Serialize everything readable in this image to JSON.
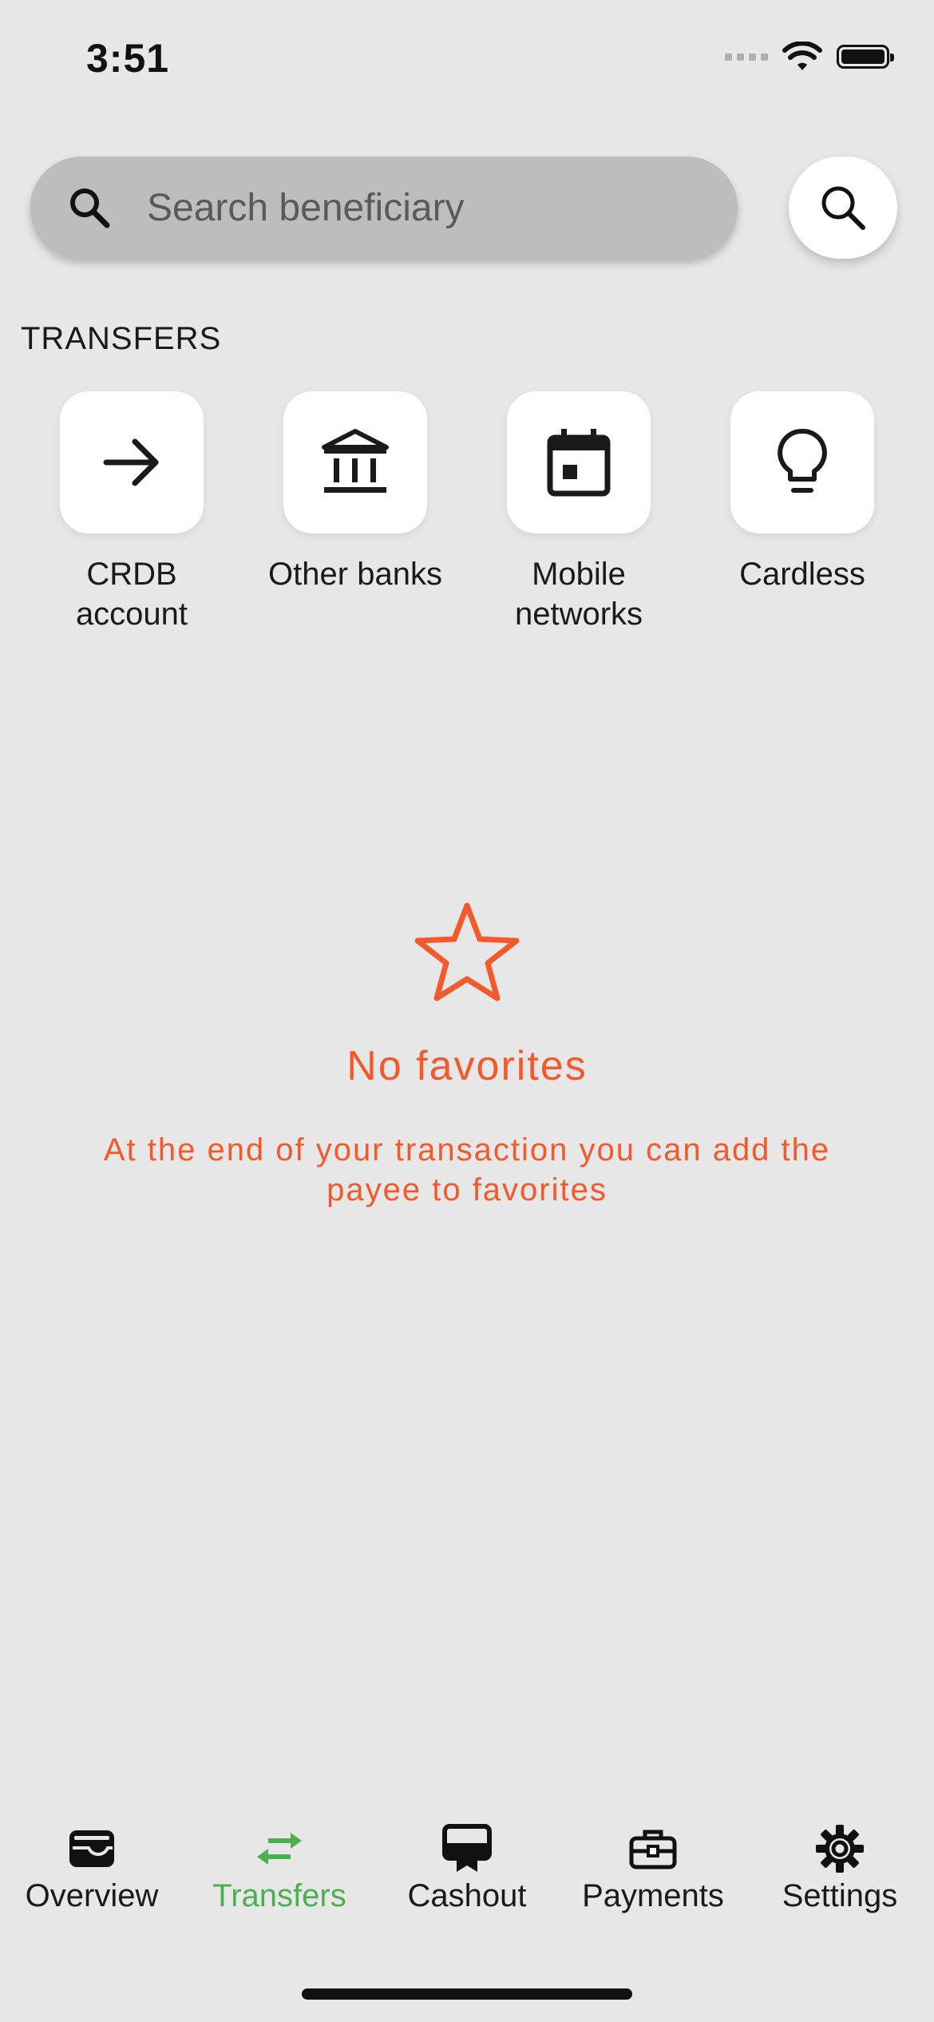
{
  "status_bar": {
    "time": "3:51"
  },
  "search": {
    "placeholder": "Search beneficiary"
  },
  "section": {
    "title": "TRANSFERS"
  },
  "tiles": [
    {
      "label": "CRDB\naccount",
      "icon": "arrow-right-icon"
    },
    {
      "label": "Other banks",
      "icon": "bank-icon"
    },
    {
      "label": "Mobile\nnetworks",
      "icon": "calendar-icon"
    },
    {
      "label": "Cardless",
      "icon": "lightbulb-icon"
    }
  ],
  "empty_state": {
    "icon": "star-outline-icon",
    "title": "No favorites",
    "description": "At the end of your transaction you can add the payee to favorites",
    "color": "#f4592b"
  },
  "bottom_nav": {
    "active_color": "#4caf50",
    "items": [
      {
        "label": "Overview",
        "icon": "wallet-icon",
        "active": false
      },
      {
        "label": "Transfers",
        "icon": "transfer-arrows-icon",
        "active": true
      },
      {
        "label": "Cashout",
        "icon": "cashout-icon",
        "active": false
      },
      {
        "label": "Payments",
        "icon": "briefcase-icon",
        "active": false
      },
      {
        "label": "Settings",
        "icon": "gear-icon",
        "active": false
      }
    ]
  }
}
